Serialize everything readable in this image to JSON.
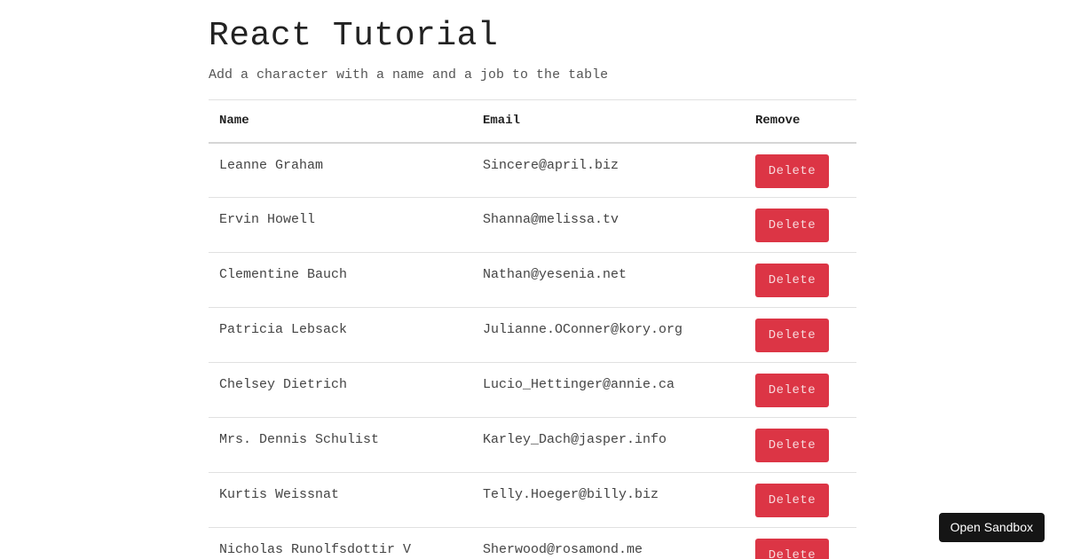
{
  "header": {
    "title": "React Tutorial",
    "subtitle": "Add a character with a name and a job to the table"
  },
  "table": {
    "columns": [
      "Name",
      "Email",
      "Remove"
    ],
    "delete_label": "Delete",
    "rows": [
      {
        "name": "Leanne Graham",
        "email": "Sincere@april.biz"
      },
      {
        "name": "Ervin Howell",
        "email": "Shanna@melissa.tv"
      },
      {
        "name": "Clementine Bauch",
        "email": "Nathan@yesenia.net"
      },
      {
        "name": "Patricia Lebsack",
        "email": "Julianne.OConner@kory.org"
      },
      {
        "name": "Chelsey Dietrich",
        "email": "Lucio_Hettinger@annie.ca"
      },
      {
        "name": "Mrs. Dennis Schulist",
        "email": "Karley_Dach@jasper.info"
      },
      {
        "name": "Kurtis Weissnat",
        "email": "Telly.Hoeger@billy.biz"
      },
      {
        "name": "Nicholas Runolfsdottir V",
        "email": "Sherwood@rosamond.me"
      }
    ]
  },
  "sandbox": {
    "label": "Open Sandbox"
  },
  "colors": {
    "danger": "#dc3545",
    "sandbox_bg": "#151515"
  }
}
